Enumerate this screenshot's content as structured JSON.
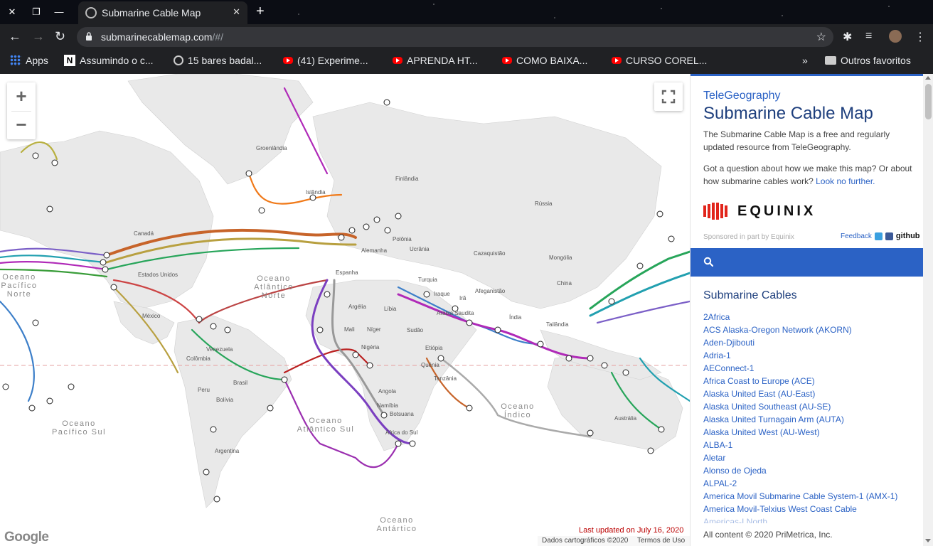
{
  "browser": {
    "tab_title": "Submarine Cable Map",
    "url_host": "submarinecablemap.com",
    "url_path": "/#/",
    "bookmarks": [
      {
        "label": "Apps",
        "icon": "apps-icon"
      },
      {
        "label": "Assumindo o c...",
        "icon": "n-site-icon"
      },
      {
        "label": "15 bares badal...",
        "icon": "globe-icon"
      },
      {
        "label": "(41) Experime...",
        "icon": "youtube-icon"
      },
      {
        "label": "APRENDA HT...",
        "icon": "youtube-icon"
      },
      {
        "label": "COMO BAIXA...",
        "icon": "youtube-icon"
      },
      {
        "label": "CURSO COREL...",
        "icon": "youtube-icon"
      }
    ],
    "other_bookmarks": "Outros favoritos"
  },
  "map": {
    "last_updated": "Last updated on July 16, 2020",
    "map_data_credit": "Dados cartográficos ©2020",
    "terms": "Termos de Uso",
    "google": "Google",
    "oceans": {
      "pacifico_norte": "Oceano Pacífico Norte",
      "atlantico_norte": "Oceano Atlântico Norte",
      "pacifico_sul": "Oceano Pacífico Sul",
      "atlantico_sul": "Oceano Atlântico Sul",
      "indico": "Oceano Índico",
      "antartico": "Oceano Antártico"
    },
    "labels": {
      "groenlandia": "Groenlândia",
      "islandia": "Islândia",
      "finlandia": "Finlândia",
      "russia": "Rússia",
      "canada": "Canadá",
      "estados_unidos": "Estados Unidos",
      "mexico": "México",
      "venezuela": "Venezuela",
      "colombia": "Colômbia",
      "brasil": "Brasil",
      "bolivia": "Bolívia",
      "argentina": "Argentina",
      "peru": "Peru",
      "alemanha": "Alemanha",
      "polonia": "Polônia",
      "ucrania": "Ucrânia",
      "espanha": "Espanha",
      "turquia": "Turquia",
      "argelia": "Argélia",
      "libia": "Líbia",
      "mali": "Mali",
      "niger": "Níger",
      "nigeria": "Nigéria",
      "sudao": "Sudão",
      "etiopia": "Etiópia",
      "quenia": "Quênia",
      "tanzania": "Tanzânia",
      "angola": "Angola",
      "namibia": "Namíbia",
      "botsuana": "Botsuana",
      "africa_do_sul": "África do Sul",
      "iraque": "Iraque",
      "ira": "Irã",
      "arabia_saudita": "Arábia Saudita",
      "afeganistao": "Afeganistão",
      "cazaquistao": "Cazaquistão",
      "mongolia": "Mongólia",
      "china": "China",
      "india": "Índia",
      "tailandia": "Tailândia",
      "australia": "Austrália"
    }
  },
  "panel": {
    "brand": "TeleGeography",
    "title": "Submarine Cable Map",
    "intro": "The Submarine Cable Map is a free and regularly updated resource from TeleGeography.",
    "question_text": "Got a question about how we make this map? Or about how submarine cables work?",
    "question_link": "Look no further.",
    "sponsor_wordmark": "EQUINIX",
    "sponsor_note": "Sponsored in part by Equinix",
    "feedback": "Feedback",
    "github": "github",
    "list_title": "Submarine Cables",
    "cables": [
      "2Africa",
      "ACS Alaska-Oregon Network (AKORN)",
      "Aden-Djibouti",
      "Adria-1",
      "AEConnect-1",
      "Africa Coast to Europe (ACE)",
      "Alaska United East (AU-East)",
      "Alaska United Southeast (AU-SE)",
      "Alaska United Turnagain Arm (AUTA)",
      "Alaska United West (AU-West)",
      "ALBA-1",
      "Aletar",
      "Alonso de Ojeda",
      "ALPAL-2",
      "America Movil Submarine Cable System-1 (AMX-1)",
      "America Movil-Telxius West Coast Cable",
      "Americas-I North"
    ],
    "footer": "All content © 2020 PriMetrica, Inc."
  }
}
